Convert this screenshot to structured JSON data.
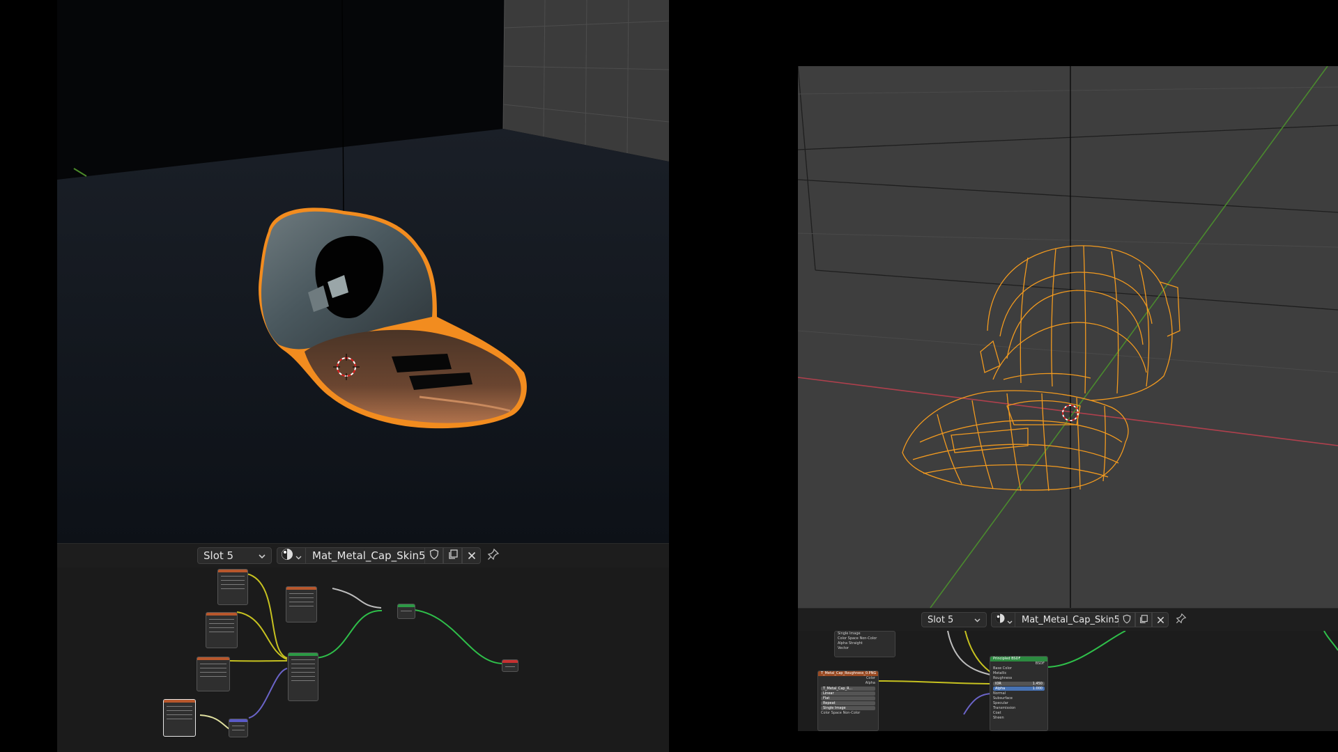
{
  "left": {
    "header": {
      "slot_label": "Slot 5",
      "material_name": "Mat_Metal_Cap_Skin5"
    },
    "icons": [
      "material-sphere-icon",
      "chevron-down-icon",
      "shield-icon",
      "duplicate-icon",
      "close-icon",
      "pin-icon"
    ]
  },
  "right": {
    "header": {
      "slot_label": "Slot 5",
      "material_name": "Mat_Metal_Cap_Skin5"
    },
    "nodes": {
      "image_node_top": {
        "rows": [
          "Single Image",
          "Color Space",
          "Alpha",
          "Vector"
        ],
        "color_space_value": "Non-Color",
        "alpha_value": "Straight"
      },
      "roughness_node": {
        "title": "T_Metal_Cap_Roughness_0.PNG",
        "outputs": [
          "Color",
          "Alpha"
        ],
        "image_name": "T_Metal_Cap_R...",
        "rows": [
          "Linear",
          "Flat",
          "Repeat",
          "Single Image"
        ],
        "color_space_label": "Color Space",
        "color_space_value": "Non-Color"
      },
      "principled": {
        "title": "Principled BSDF",
        "output": "BSDF",
        "inputs": [
          "Base Color",
          "Metallic",
          "Roughness"
        ],
        "ior_label": "IOR",
        "ior_value": "1.450",
        "alpha_label": "Alpha",
        "alpha_value": "1.000",
        "sections": [
          "Normal",
          "Subsurface",
          "Specular",
          "Transmission",
          "Coat",
          "Sheen"
        ]
      }
    }
  }
}
